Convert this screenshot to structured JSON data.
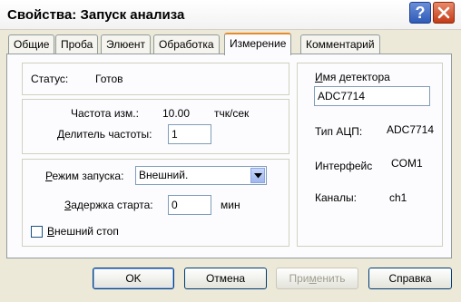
{
  "window": {
    "title": "Свойства: Запуск анализа",
    "help_icon": "question-icon",
    "close_icon": "close-icon"
  },
  "tabs": [
    {
      "label": "Общие",
      "active": false
    },
    {
      "label": "Проба",
      "active": false
    },
    {
      "label": "Элюент",
      "active": false
    },
    {
      "label": "Обработка",
      "active": false
    },
    {
      "label": "Измерение",
      "active": true
    },
    {
      "label": "Комментарий",
      "active": false
    }
  ],
  "status": {
    "label": "Статус:",
    "value": "Готовs"
  },
  "frequency": {
    "label": "Частота изм.:",
    "value": "10.00",
    "unit": "тчк/сек"
  },
  "divider": {
    "label": "Делитель частоты:",
    "value": "1"
  },
  "launch": {
    "mode_label": "Режим запуска:",
    "mode_value": "Внешний.",
    "delay_label": "Задержка старта:",
    "delay_value": "0",
    "delay_unit": "мин",
    "external_stop_label": "Внешний стоп",
    "external_stop_checked": false
  },
  "detector": {
    "name_label": "Имя детектора",
    "name_value": "ADC7714",
    "adc_type_label": "Тип АЦП:",
    "adc_type_value": "ADC7714",
    "interface_label": "Интерфейс",
    "interface_value": "COM1",
    "channels_label": "Каналы:",
    "channels_value": "ch1"
  },
  "buttons": {
    "ok": "OK",
    "cancel": "Отмена",
    "apply": "Применить",
    "help": "Справка"
  }
}
